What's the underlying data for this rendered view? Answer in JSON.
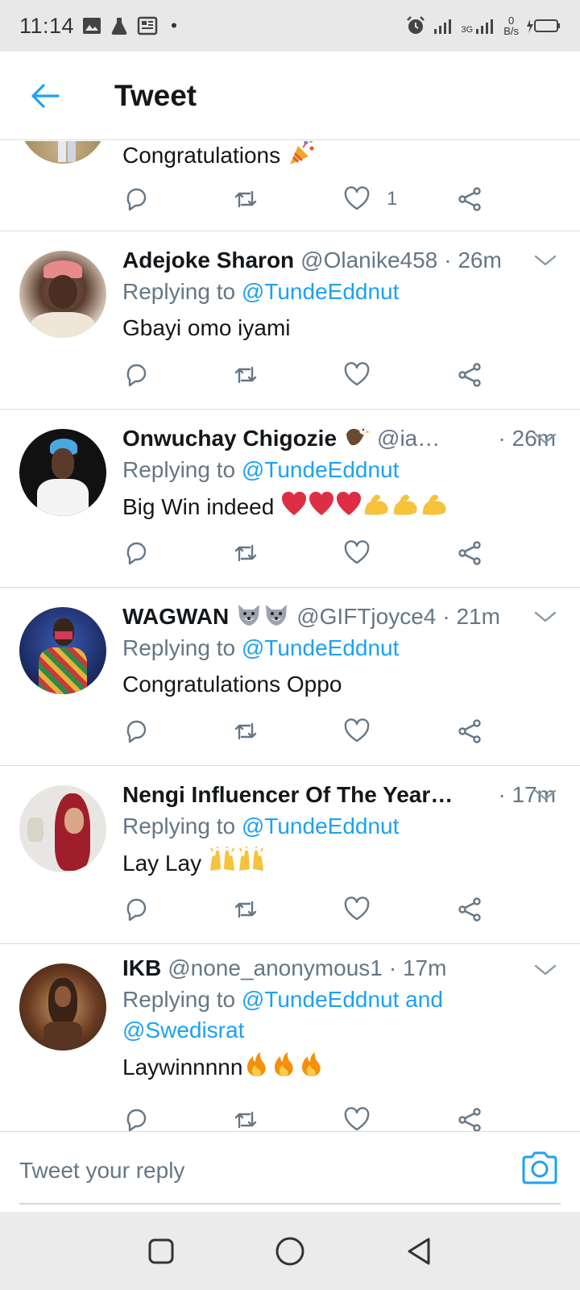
{
  "status_bar": {
    "time": "11:14",
    "network": "3G",
    "speed_value": "0",
    "speed_unit": "B/s"
  },
  "header": {
    "title": "Tweet",
    "accent": "#1da1f2"
  },
  "tweets": [
    {
      "name": "",
      "handle": "",
      "time": "",
      "text": "Congratulations",
      "emoji": "party-popper",
      "like_count": "1"
    },
    {
      "name": "Adejoke Sharon",
      "handle": "@Olanike458",
      "time": "· 26m",
      "replying_prefix": "Replying to ",
      "replying_to": "@TundeEddnut",
      "text": "Gbayi omo iyami"
    },
    {
      "name": "Onwuchay Chigozie",
      "handle": "@ia…",
      "time": "· 26m",
      "replying_prefix": "Replying to ",
      "replying_to": "@TundeEddnut",
      "text": "Big Win indeed",
      "emojis": [
        "heart",
        "heart",
        "heart",
        "flexed-biceps",
        "flexed-biceps",
        "flexed-biceps"
      ]
    },
    {
      "name": "WAGWAN",
      "handle": "@GIFTjoyce4",
      "time": "· 21m",
      "replying_prefix": "Replying to ",
      "replying_to": "@TundeEddnut",
      "text": "Congratulations Oppo"
    },
    {
      "name": "Nengi Influencer Of The Year…",
      "handle": "",
      "time": "· 17m",
      "replying_prefix": "Replying to ",
      "replying_to": "@TundeEddnut",
      "text": "Lay Lay",
      "emojis": [
        "raising-hands",
        "raising-hands"
      ]
    },
    {
      "name": "IKB",
      "handle": "@none_anonymous1",
      "time": "· 17m",
      "replying_prefix": "Replying to ",
      "replying_to": "@TundeEddnut and",
      "replying_to_2": "@Swedisrat",
      "text": "Laywinnnnn",
      "emojis": [
        "fire",
        "fire",
        "fire"
      ]
    }
  ],
  "reply_bar": {
    "placeholder": "Tweet your reply"
  },
  "colors": {
    "accent": "#1da1f2",
    "secondary_text": "#657786",
    "divider": "#d6dbdf"
  }
}
